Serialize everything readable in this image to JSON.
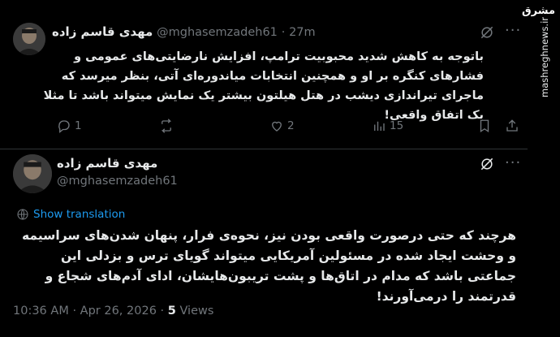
{
  "tweet1": {
    "author_name": "مهدی قاسم زاده",
    "handle": "@mghasemzadeh61",
    "separator": "·",
    "time": "27m",
    "body": "باتوجه به کاهش شدید محبوبیت ترامپ، افزایش نارضایتی‌های عمومی و فشارهای کنگره بر او و همچنین انتخابات میاندوره‌ای آتی، بنظر میرسد که ماجرای تیراندازی دیشب در هتل هیلتون بیشتر یک نمایش میتواند باشد تا مثلا یک اتفاق واقعی!",
    "replies": "1",
    "retweets": "",
    "likes": "2",
    "views": "15"
  },
  "tweet2": {
    "author_name": "مهدی قاسم زاده",
    "handle": "@mghasemzadeh61",
    "show_translation": "Show translation",
    "body": "هرچند که حتی درصورت واقعی بودن نیز، نحوه‌ی فرار، پنهان شدن‌های سراسیمه و وحشت ایجاد شده در مسئولین آمریکایی میتواند گویای ترس و بزدلی این جماعتی باشد که مدام در اتاق‌ها و پشت تریبون‌هایشان، ادای آدم‌های شجاع و قدرتمند را درمی‌آورند!",
    "time": "10:36 AM",
    "separator": "·",
    "date": "Apr 26, 2026",
    "views_count": "5",
    "views_label": "Views"
  },
  "watermark": {
    "logo": "مشرق",
    "site": "mashreghnews.ir"
  },
  "icons": {
    "reply": "reply-icon",
    "retweet": "retweet-icon",
    "like": "heart-icon",
    "views": "views-chart-icon",
    "bookmark": "bookmark-icon",
    "share": "share-icon",
    "grok": "grok-icon",
    "more": "more-icon",
    "translate": "globe-icon"
  },
  "colors": {
    "background": "#000000",
    "text": "#e7e9ea",
    "secondary": "#71767b",
    "link": "#1d9bf0",
    "border": "#2f3336"
  }
}
